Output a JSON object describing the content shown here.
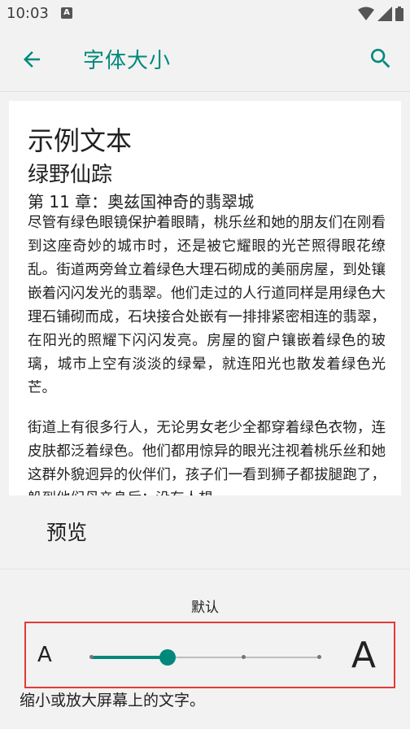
{
  "status_bar": {
    "time": "10:03",
    "notification_icon": "A",
    "icons": [
      "wifi-icon",
      "signal-icon",
      "battery-icon"
    ]
  },
  "app_bar": {
    "title": "字体大小",
    "back_icon": "arrow-back-icon",
    "search_icon": "search-icon",
    "accent_color": "#00897b"
  },
  "preview": {
    "sample_heading": "示例文本",
    "book_title": "绿野仙踪",
    "chapter_title": "第 11 章：奥兹国神奇的翡翠城",
    "paragraphs": [
      "尽管有绿色眼镜保护着眼睛，桃乐丝和她的朋友们在刚看到这座奇妙的城市时，还是被它耀眼的光芒照得眼花缭乱。街道两旁耸立着绿色大理石砌成的美丽房屋，到处镶嵌着闪闪发光的翡翠。他们走过的人行道同样是用绿色大理石铺砌而成，石块接合处嵌有一排排紧密相连的翡翠，在阳光的照耀下闪闪发亮。房屋的窗户镶嵌着绿色的玻璃，城市上空有淡淡的绿晕，就连阳光也散发着绿色光芒。",
      "街道上有很多行人，无论男女老少全都穿着绿色衣物，连皮肤都泛着绿色。他们都用惊异的眼光注视着桃乐丝和她这群外貌迥异的伙伴们，孩子们一看到狮子都拔腿跑了，躲到他们母亲身后；没有人想"
    ],
    "label": "预览"
  },
  "font_size": {
    "current_label": "默认",
    "small_label": "A",
    "large_label": "A",
    "levels": 4,
    "selected_index": 1,
    "hint": "缩小或放大屏幕上的文字。"
  }
}
